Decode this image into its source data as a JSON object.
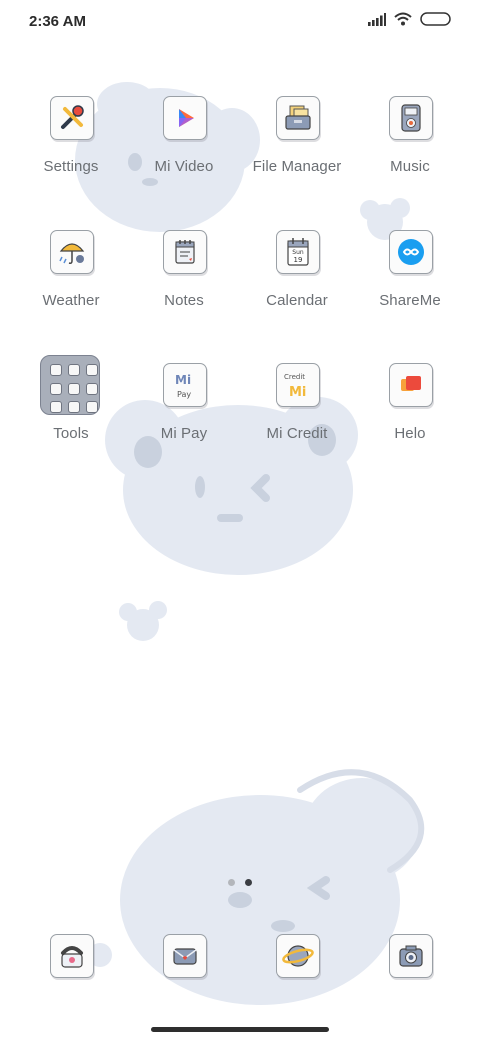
{
  "status_bar": {
    "time": "2:36 AM",
    "icons": [
      "signal-icon",
      "wifi-icon",
      "battery-icon"
    ]
  },
  "apps": [
    {
      "label": "Settings",
      "icon": "settings-icon"
    },
    {
      "label": "Mi Video",
      "icon": "mi-video-icon"
    },
    {
      "label": "File Manager",
      "icon": "file-manager-icon"
    },
    {
      "label": "Music",
      "icon": "music-icon"
    },
    {
      "label": "Weather",
      "icon": "weather-icon"
    },
    {
      "label": "Notes",
      "icon": "notes-icon"
    },
    {
      "label": "Calendar",
      "icon": "calendar-icon"
    },
    {
      "label": "ShareMe",
      "icon": "shareme-icon"
    },
    {
      "label": "Tools",
      "icon": "tools-folder-icon"
    },
    {
      "label": "Mi Pay",
      "icon": "mi-pay-icon"
    },
    {
      "label": "Mi Credit",
      "icon": "mi-credit-icon"
    },
    {
      "label": "Helo",
      "icon": "helo-icon"
    }
  ],
  "calendar_icon": {
    "weekday": "Sun",
    "day": "19"
  },
  "mi_credit_icon": {
    "text": "Credit",
    "logo": "Mi"
  },
  "mi_pay_icon": {
    "logo": "Mi",
    "text": "Pay"
  },
  "pages": {
    "count": 2,
    "current": 2
  },
  "dock": [
    {
      "icon": "phone-icon"
    },
    {
      "icon": "messages-icon"
    },
    {
      "icon": "browser-icon"
    },
    {
      "icon": "camera-icon"
    }
  ],
  "colors": {
    "wallpaper_bear": "#e3e8f1",
    "icon_border": "#9aa0a6",
    "folder": "#a9afba"
  }
}
